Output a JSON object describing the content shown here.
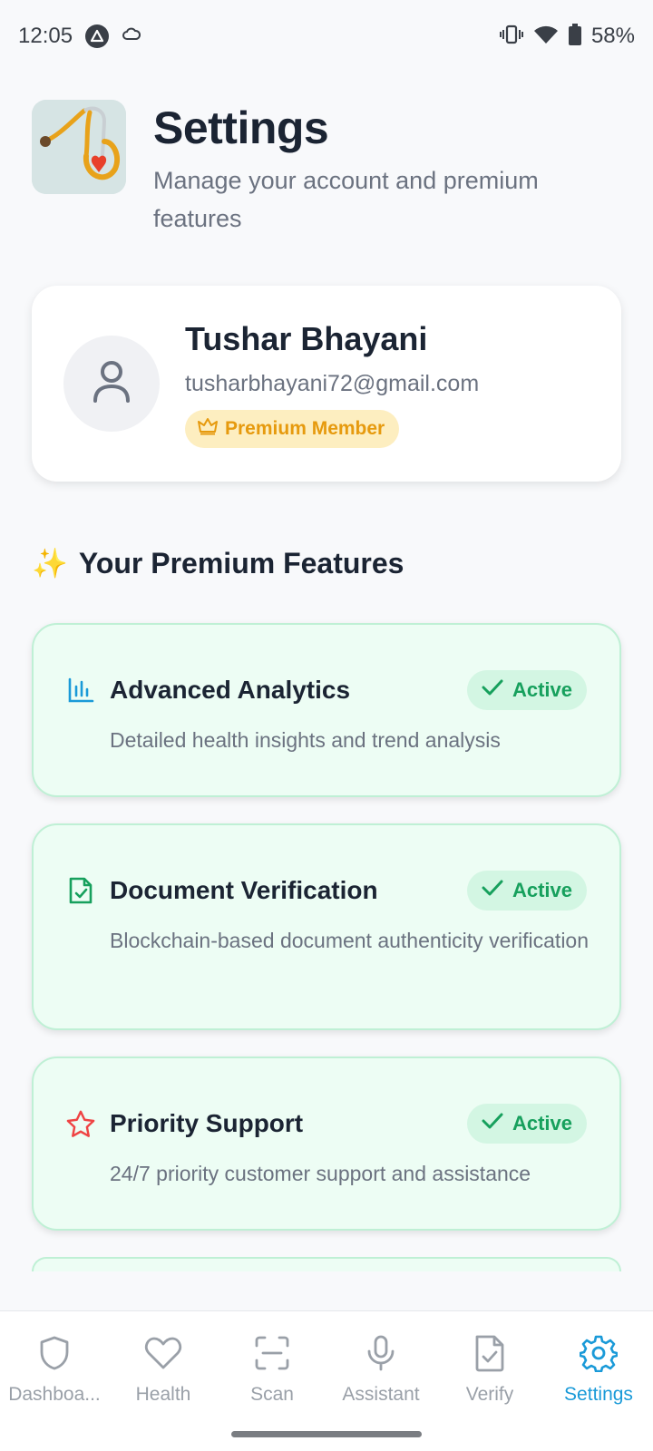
{
  "status_bar": {
    "time": "12:05",
    "battery": "58%"
  },
  "header": {
    "title": "Settings",
    "subtitle": "Manage your account and premium features"
  },
  "profile": {
    "name": "Tushar Bhayani",
    "email": "tusharbhayani72@gmail.com",
    "badge": "Premium Member"
  },
  "section": {
    "title": "Your Premium Features",
    "emoji": "✨"
  },
  "features": [
    {
      "title": "Advanced Analytics",
      "description": "Detailed health insights and trend analysis",
      "status": "Active",
      "icon": "bar-chart-icon",
      "icon_color": "#1a9ad8"
    },
    {
      "title": "Document Verification",
      "description": "Blockchain-based document authenticity verification",
      "status": "Active",
      "icon": "file-check-icon",
      "icon_color": "#17a05d"
    },
    {
      "title": "Priority Support",
      "description": "24/7 priority customer support and assistance",
      "status": "Active",
      "icon": "star-icon",
      "icon_color": "#ef4444"
    }
  ],
  "nav": {
    "items": [
      {
        "label": "Dashboa...",
        "icon": "shield-icon",
        "active": false
      },
      {
        "label": "Health",
        "icon": "heart-icon",
        "active": false
      },
      {
        "label": "Scan",
        "icon": "scan-icon",
        "active": false
      },
      {
        "label": "Assistant",
        "icon": "mic-icon",
        "active": false
      },
      {
        "label": "Verify",
        "icon": "file-check-icon",
        "active": false
      },
      {
        "label": "Settings",
        "icon": "gear-icon",
        "active": true
      }
    ]
  },
  "colors": {
    "accent": "#1a9ad8",
    "success": "#17a05d",
    "premium": "#e69a0e",
    "feature_bg": "#edfdf4"
  }
}
